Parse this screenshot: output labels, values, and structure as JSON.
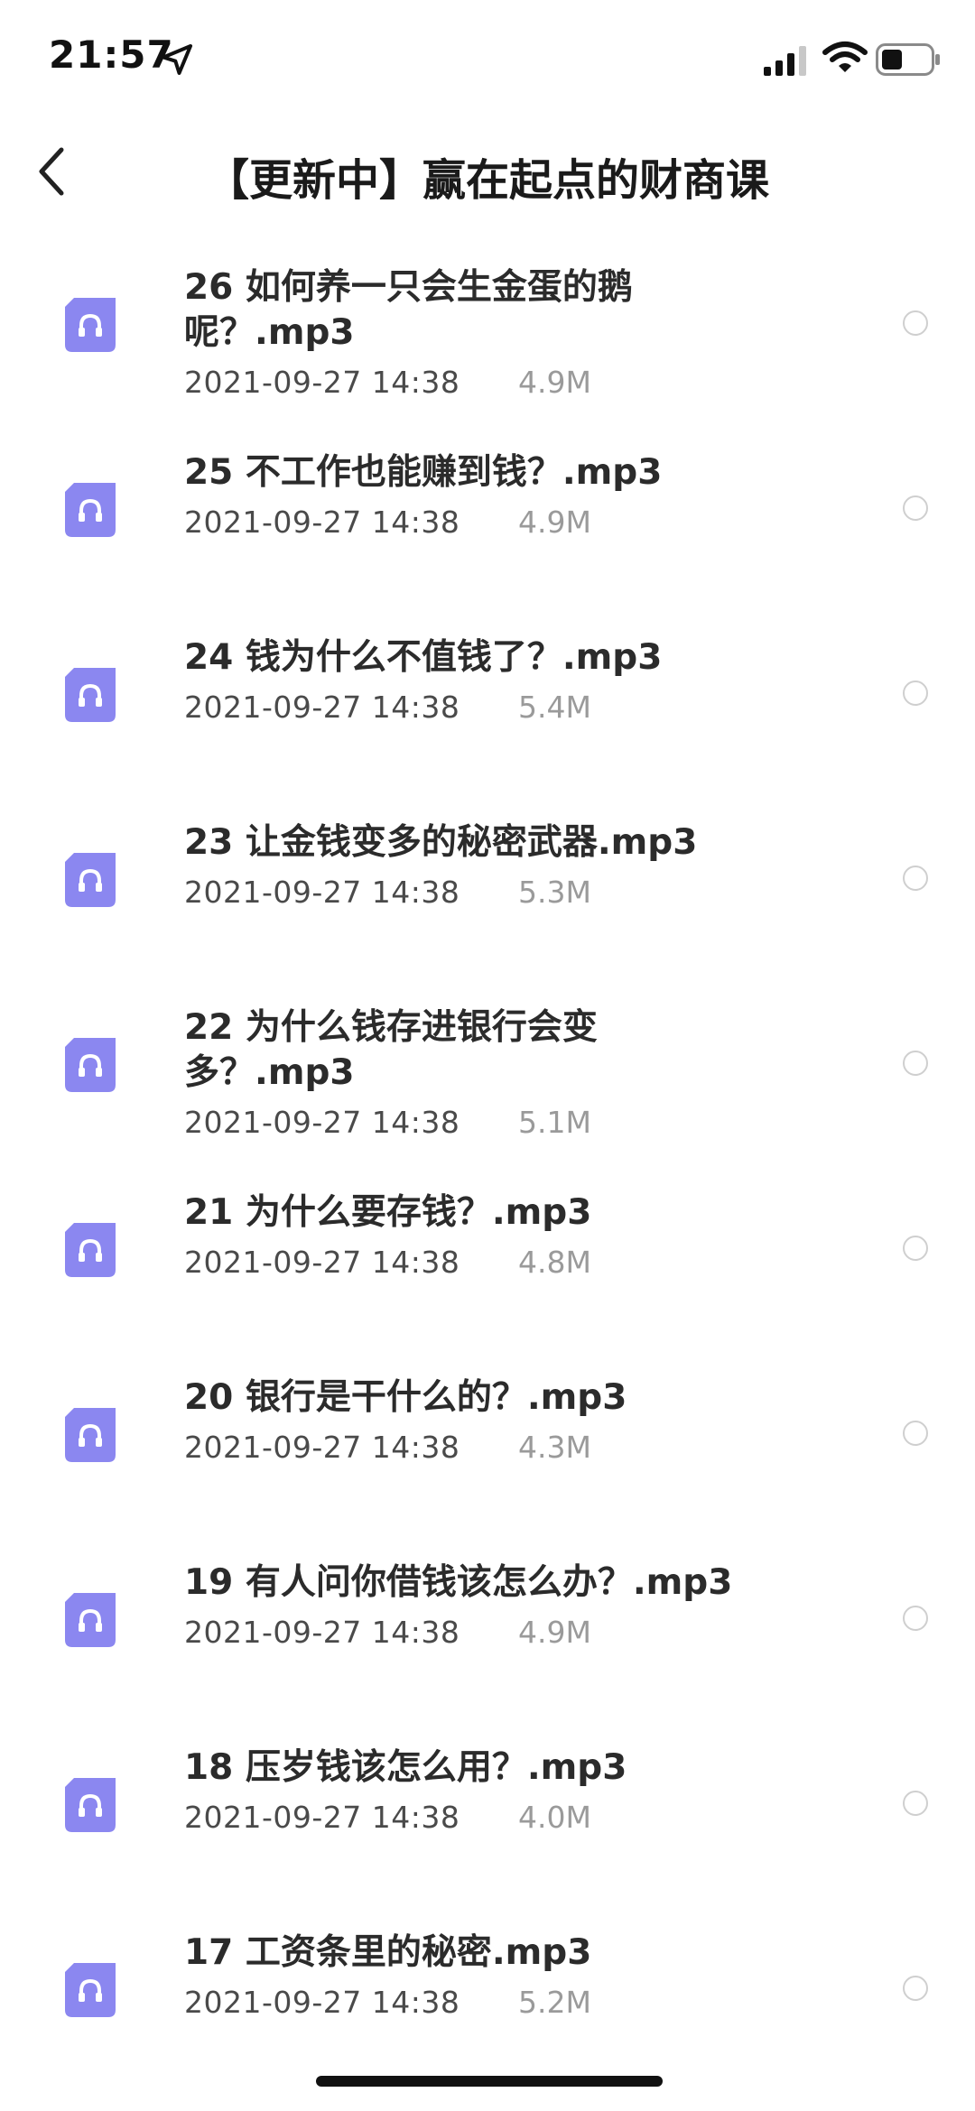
{
  "status_bar": {
    "time": "21:57"
  },
  "nav": {
    "title": "【更新中】赢在起点的财商课"
  },
  "files": [
    {
      "name": "26 如何养一只会生金蛋的鹅呢？.mp3",
      "date": "2021-09-27 14:38",
      "size": "4.9M"
    },
    {
      "name": "25 不工作也能赚到钱？.mp3",
      "date": "2021-09-27 14:38",
      "size": "4.9M"
    },
    {
      "name": "24 钱为什么不值钱了？.mp3",
      "date": "2021-09-27 14:38",
      "size": "5.4M"
    },
    {
      "name": "23 让金钱变多的秘密武器.mp3",
      "date": "2021-09-27 14:38",
      "size": "5.3M"
    },
    {
      "name": "22 为什么钱存进银行会变多？.mp3",
      "date": "2021-09-27 14:38",
      "size": "5.1M"
    },
    {
      "name": "21 为什么要存钱？.mp3",
      "date": "2021-09-27 14:38",
      "size": "4.8M"
    },
    {
      "name": "20 银行是干什么的？.mp3",
      "date": "2021-09-27 14:38",
      "size": "4.3M"
    },
    {
      "name": "19 有人问你借钱该怎么办？.mp3",
      "date": "2021-09-27 14:38",
      "size": "4.9M"
    },
    {
      "name": "18 压岁钱该怎么用？.mp3",
      "date": "2021-09-27 14:38",
      "size": "4.0M"
    },
    {
      "name": "17 工资条里的秘密.mp3",
      "date": "2021-09-27 14:38",
      "size": "5.2M"
    }
  ],
  "icons": {
    "file_icon": "audio-file-icon",
    "file_icon_color": "#8b87f0"
  }
}
